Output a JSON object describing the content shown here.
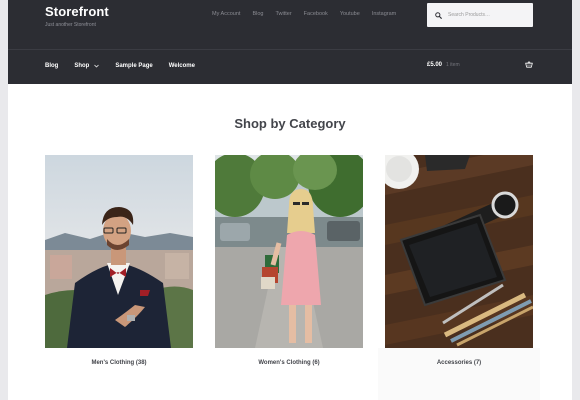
{
  "site": {
    "title": "Storefront",
    "tagline": "Just another Storefront"
  },
  "secondary_nav": [
    "My Account",
    "Blog",
    "Twitter",
    "Facebook",
    "Youtube",
    "Instagram"
  ],
  "search": {
    "placeholder": "Search Products…",
    "icon": "search-icon"
  },
  "primary_nav": [
    {
      "label": "Blog",
      "has_dropdown": false
    },
    {
      "label": "Shop",
      "has_dropdown": true
    },
    {
      "label": "Sample Page",
      "has_dropdown": false
    },
    {
      "label": "Welcome",
      "has_dropdown": false
    }
  ],
  "cart": {
    "amount": "£5.00",
    "count": "1 item",
    "icon": "basket-icon"
  },
  "section": {
    "title": "Shop by Category"
  },
  "categories": [
    {
      "label": "Men's Clothing (38)"
    },
    {
      "label": "Women's Clothing (6)"
    },
    {
      "label": "Accessories (7)"
    }
  ],
  "colors": {
    "header_bg": "#2c2d33",
    "text_dark": "#43454b",
    "nav_muted": "#8a8b92"
  }
}
